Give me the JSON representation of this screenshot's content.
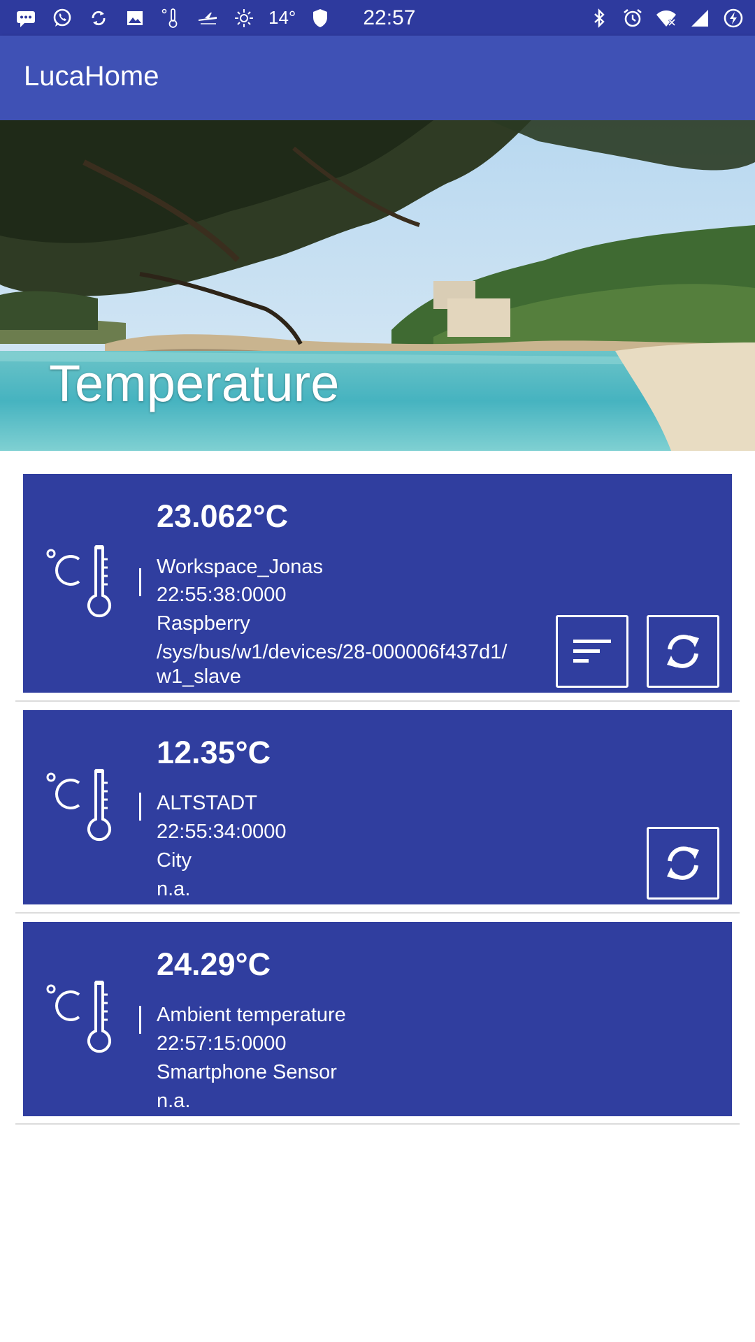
{
  "status_bar": {
    "temperature": "14°",
    "time": "22:57",
    "left_icons": [
      "messages-icon",
      "whatsapp-icon",
      "sync-icon",
      "gallery-icon",
      "sensor-icon",
      "plane-icon",
      "brightness-icon"
    ],
    "right_icons": [
      "bluetooth-icon",
      "alarm-icon",
      "wifi-icon",
      "signal-icon",
      "battery-charging-icon"
    ]
  },
  "app_bar": {
    "title": "LucaHome"
  },
  "header": {
    "title": "Temperature"
  },
  "colors": {
    "status_bar": "#2e3a9e",
    "app_bar": "#3f51b5",
    "card": "#303e9f",
    "text": "#ffffff"
  },
  "cards": [
    {
      "temperature": "23.062°C",
      "name": "Workspace_Jonas",
      "time": "22:55:38:0000",
      "source": "Raspberry",
      "path_line1": "/sys/bus/w1/devices/28-000006f437d1/",
      "path_line2": "w1_slave",
      "icon": "thermometer-celsius-icon",
      "actions": [
        "sort-icon",
        "refresh-icon"
      ]
    },
    {
      "temperature": "12.35°C",
      "name": "ALTSTADT",
      "time": "22:55:34:0000",
      "source": "City",
      "path": "n.a.",
      "icon": "thermometer-celsius-icon",
      "actions": [
        "refresh-icon"
      ]
    },
    {
      "temperature": "24.29°C",
      "name": "Ambient temperature",
      "time": "22:57:15:0000",
      "source": "Smartphone Sensor",
      "path": "n.a.",
      "icon": "thermometer-celsius-icon",
      "actions": []
    }
  ]
}
